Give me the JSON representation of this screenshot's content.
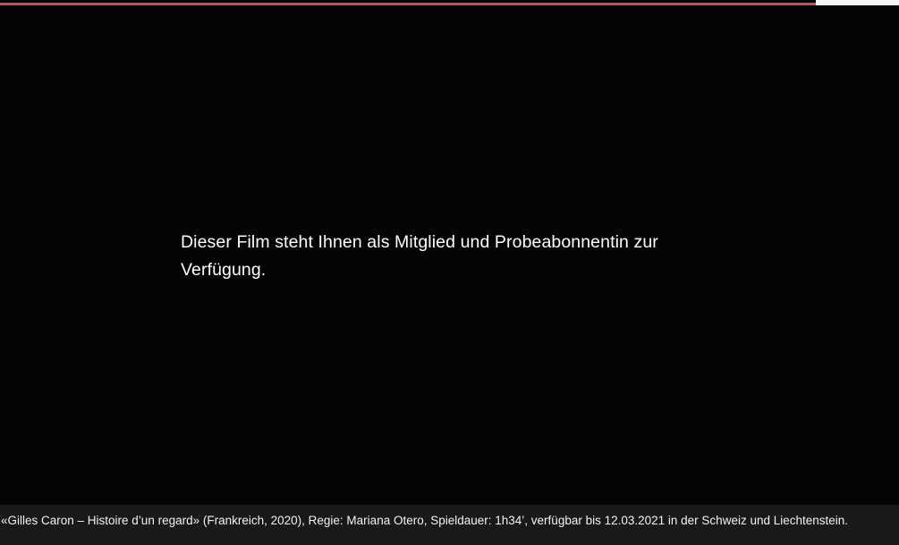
{
  "colors": {
    "background": "#040404",
    "progress": "#c8504c",
    "caption_bar": "#191919",
    "text": "#ffffff"
  },
  "player": {
    "progress_fraction": 0.907,
    "message": "Dieser Film steht Ihnen als Mitglied und Probeabonnentin zur Verfügung."
  },
  "caption": {
    "text": "«Gilles Caron – Histoire d’un regard» (Frankreich, 2020), Regie: Mariana Otero, Spieldauer: 1h34’, verfügbar bis 12.03.2021 in der Schweiz und Liechtenstein."
  }
}
